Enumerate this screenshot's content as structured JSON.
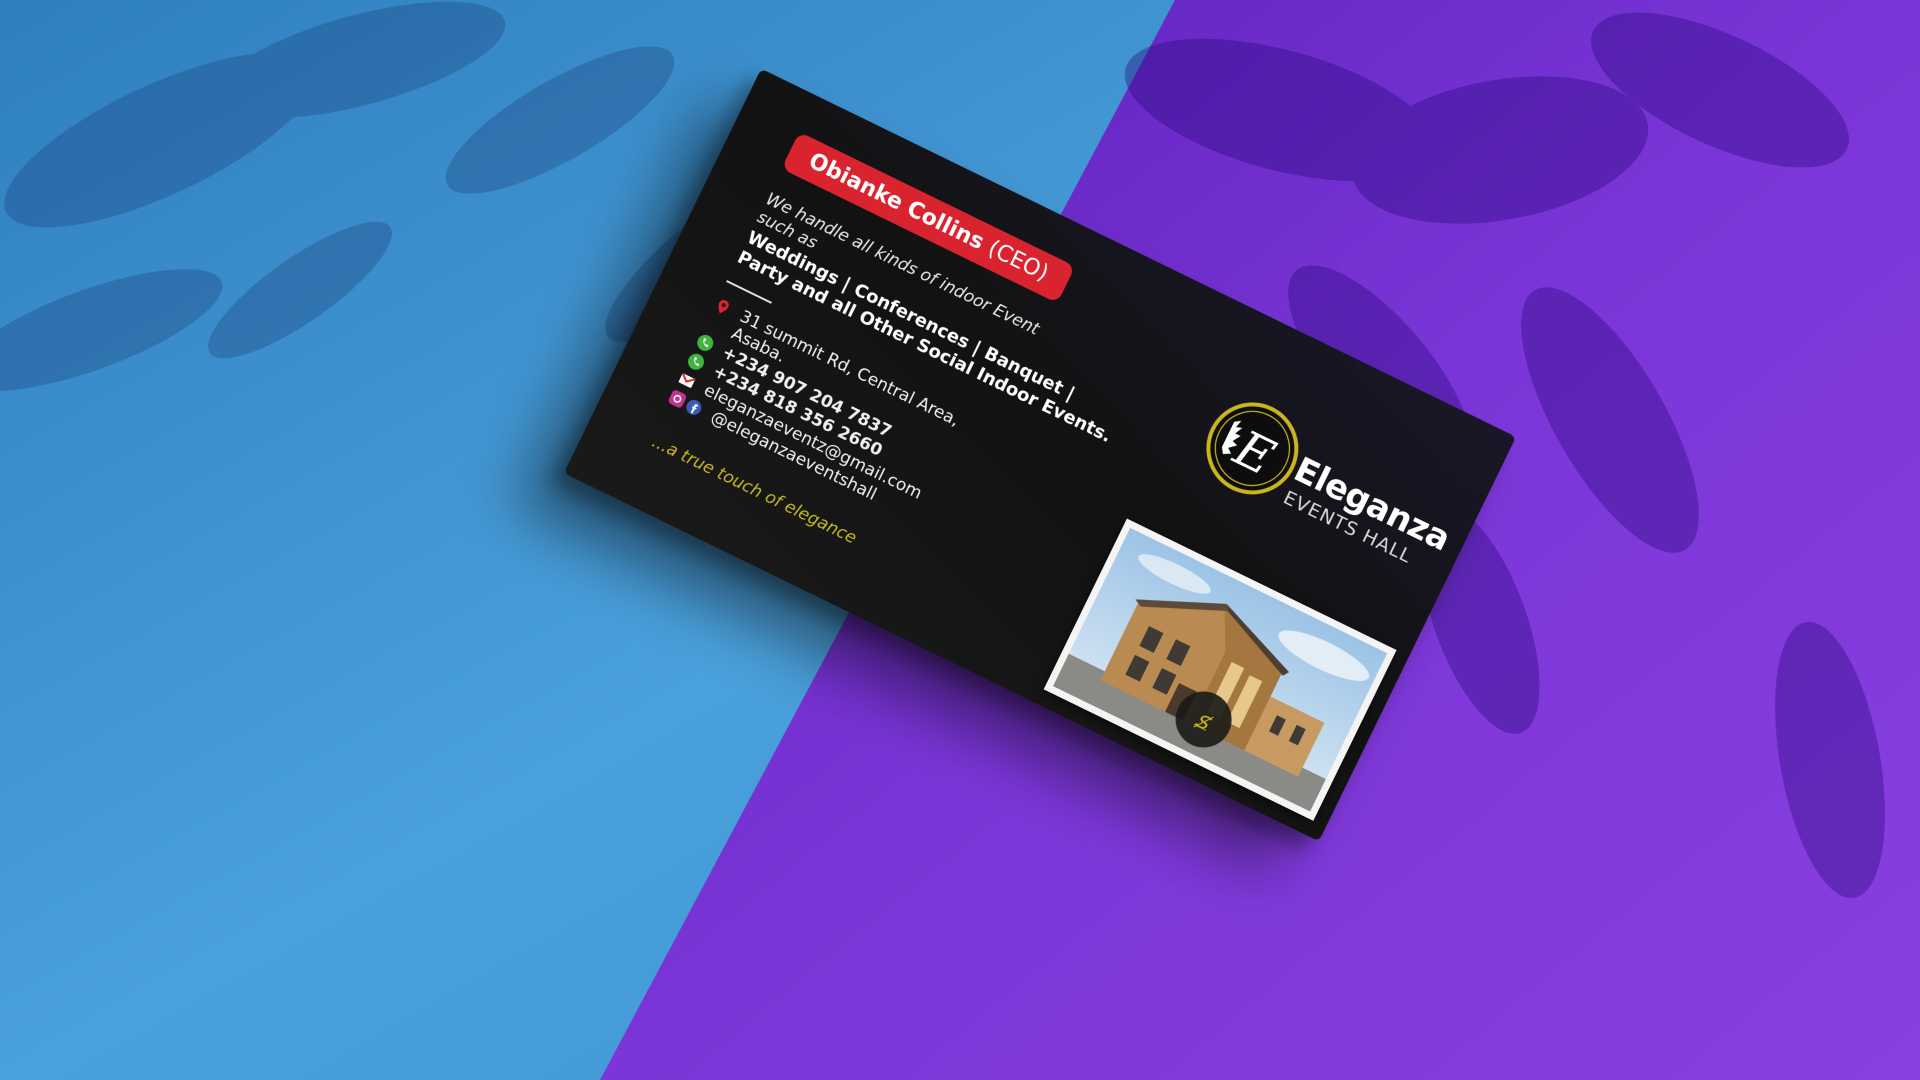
{
  "card": {
    "name": "Obianke Collins",
    "role": "(CEO)",
    "intro_line1": "We handle all kinds of indoor Event",
    "intro_line2": "such as",
    "services_line1": "Weddings  | Conferences  | Banquet |",
    "services_line2": "Party and all Other Social Indoor Events.",
    "address_line1": "31 summit Rd, Central Area,",
    "address_line2": "Asaba.",
    "phone1": "+234 907 204 7837",
    "phone2": "+234 818 356 2660",
    "email": "eleganzaeventz@gmail.com",
    "social": "@eleganzaeventshall",
    "tagline": "...a true touch of elegance"
  },
  "brand": {
    "emblem_letter": "E",
    "name": "Eleganza",
    "subtitle": "EVENTS HALL",
    "gold": "#c9b51e"
  },
  "icons": {
    "location": "map-pin-icon",
    "phone": "phone-icon",
    "email": "mail-icon",
    "instagram": "instagram-icon",
    "facebook": "facebook-icon"
  },
  "colors": {
    "background_left": "#3e92cc",
    "background_right": "#7a35d6",
    "card": "#121212",
    "badge": "#d9232e"
  }
}
